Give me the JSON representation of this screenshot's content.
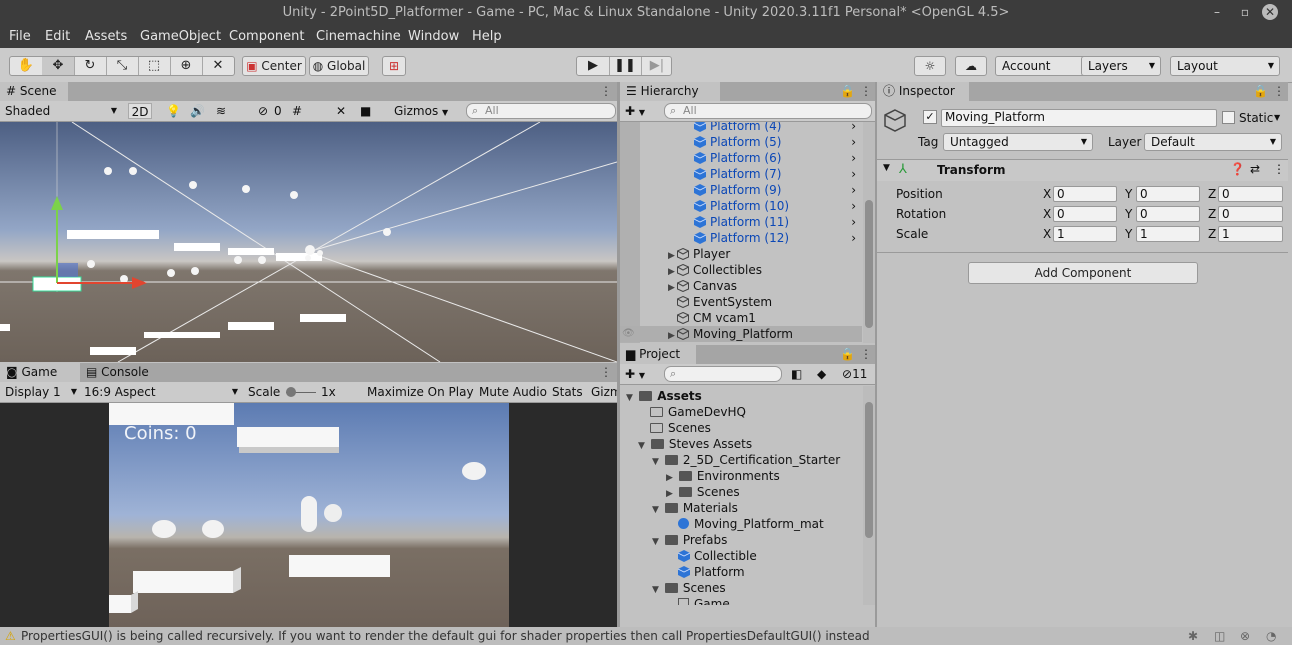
{
  "window": {
    "title": "Unity - 2Point5D_Platformer - Game - PC, Mac & Linux Standalone - Unity 2020.3.11f1 Personal* <OpenGL 4.5>"
  },
  "menu": {
    "items": [
      "File",
      "Edit",
      "Assets",
      "GameObject",
      "Component",
      "Cinemachine",
      "Window",
      "Help"
    ]
  },
  "toolbar": {
    "pivot_label": "Center",
    "space_label": "Global",
    "account_label": "Account",
    "layers_label": "Layers",
    "layout_label": "Layout"
  },
  "scene": {
    "tab_label": "Scene",
    "shading_mode": "Shaded",
    "mode_2d": "2D",
    "hidden_count": "0",
    "gizmos_label": "Gizmos",
    "search_placeholder": "All"
  },
  "game": {
    "tab_label": "Game",
    "console_tab_label": "Console",
    "display": "Display 1",
    "aspect": "16:9 Aspect",
    "scale_label": "Scale",
    "scale_value": "1x",
    "maximize_label": "Maximize On Play",
    "mute_label": "Mute Audio",
    "stats_label": "Stats",
    "gizmos_label": "Gizm",
    "coins_text": "Coins: 0"
  },
  "hierarchy": {
    "tab_label": "Hierarchy",
    "search_placeholder": "All",
    "items": [
      {
        "label": "Platform (4)",
        "prefab": true
      },
      {
        "label": "Platform (5)",
        "prefab": true
      },
      {
        "label": "Platform (6)",
        "prefab": true
      },
      {
        "label": "Platform (7)",
        "prefab": true
      },
      {
        "label": "Platform (9)",
        "prefab": true
      },
      {
        "label": "Platform (10)",
        "prefab": true
      },
      {
        "label": "Platform (11)",
        "prefab": true
      },
      {
        "label": "Platform (12)",
        "prefab": true
      },
      {
        "label": "Player",
        "prefab": false
      },
      {
        "label": "Collectibles",
        "prefab": false
      },
      {
        "label": "Canvas",
        "prefab": false
      },
      {
        "label": "EventSystem",
        "prefab": false
      },
      {
        "label": "CM vcam1",
        "prefab": false
      },
      {
        "label": "Moving_Platform",
        "prefab": false
      }
    ]
  },
  "project": {
    "tab_label": "Project",
    "hidden_count": "11",
    "tree": {
      "assets": "Assets",
      "gamedevhq": "GameDevHQ",
      "scenes_root": "Scenes",
      "steves_assets": "Steves Assets",
      "starter": "2_5D_Certification_Starter",
      "environments": "Environments",
      "starter_scenes": "Scenes",
      "materials": "Materials",
      "moving_platform_mat": "Moving_Platform_mat",
      "prefabs": "Prefabs",
      "collectible": "Collectible",
      "platform": "Platform",
      "scenes": "Scenes",
      "game_scene": "Game"
    }
  },
  "inspector": {
    "tab_label": "Inspector",
    "object_name": "Moving_Platform",
    "static_label": "Static",
    "tag_label": "Tag",
    "tag_value": "Untagged",
    "layer_label": "Layer",
    "layer_value": "Default",
    "transform": {
      "title": "Transform",
      "position_label": "Position",
      "rotation_label": "Rotation",
      "scale_label": "Scale",
      "axis_x": "X",
      "axis_y": "Y",
      "axis_z": "Z",
      "position": {
        "x": "0",
        "y": "0",
        "z": "0"
      },
      "rotation": {
        "x": "0",
        "y": "0",
        "z": "0"
      },
      "scale": {
        "x": "1",
        "y": "1",
        "z": "1"
      }
    },
    "add_component_label": "Add Component"
  },
  "status": {
    "message": "PropertiesGUI() is being called recursively. If you want to render the default gui for shader properties then call PropertiesDefaultGUI() instead"
  },
  "colors": {
    "selection_blue": "#0b47b6",
    "dark_chrome": "#3c3c3c",
    "panel_gray": "#c2c2c2"
  }
}
